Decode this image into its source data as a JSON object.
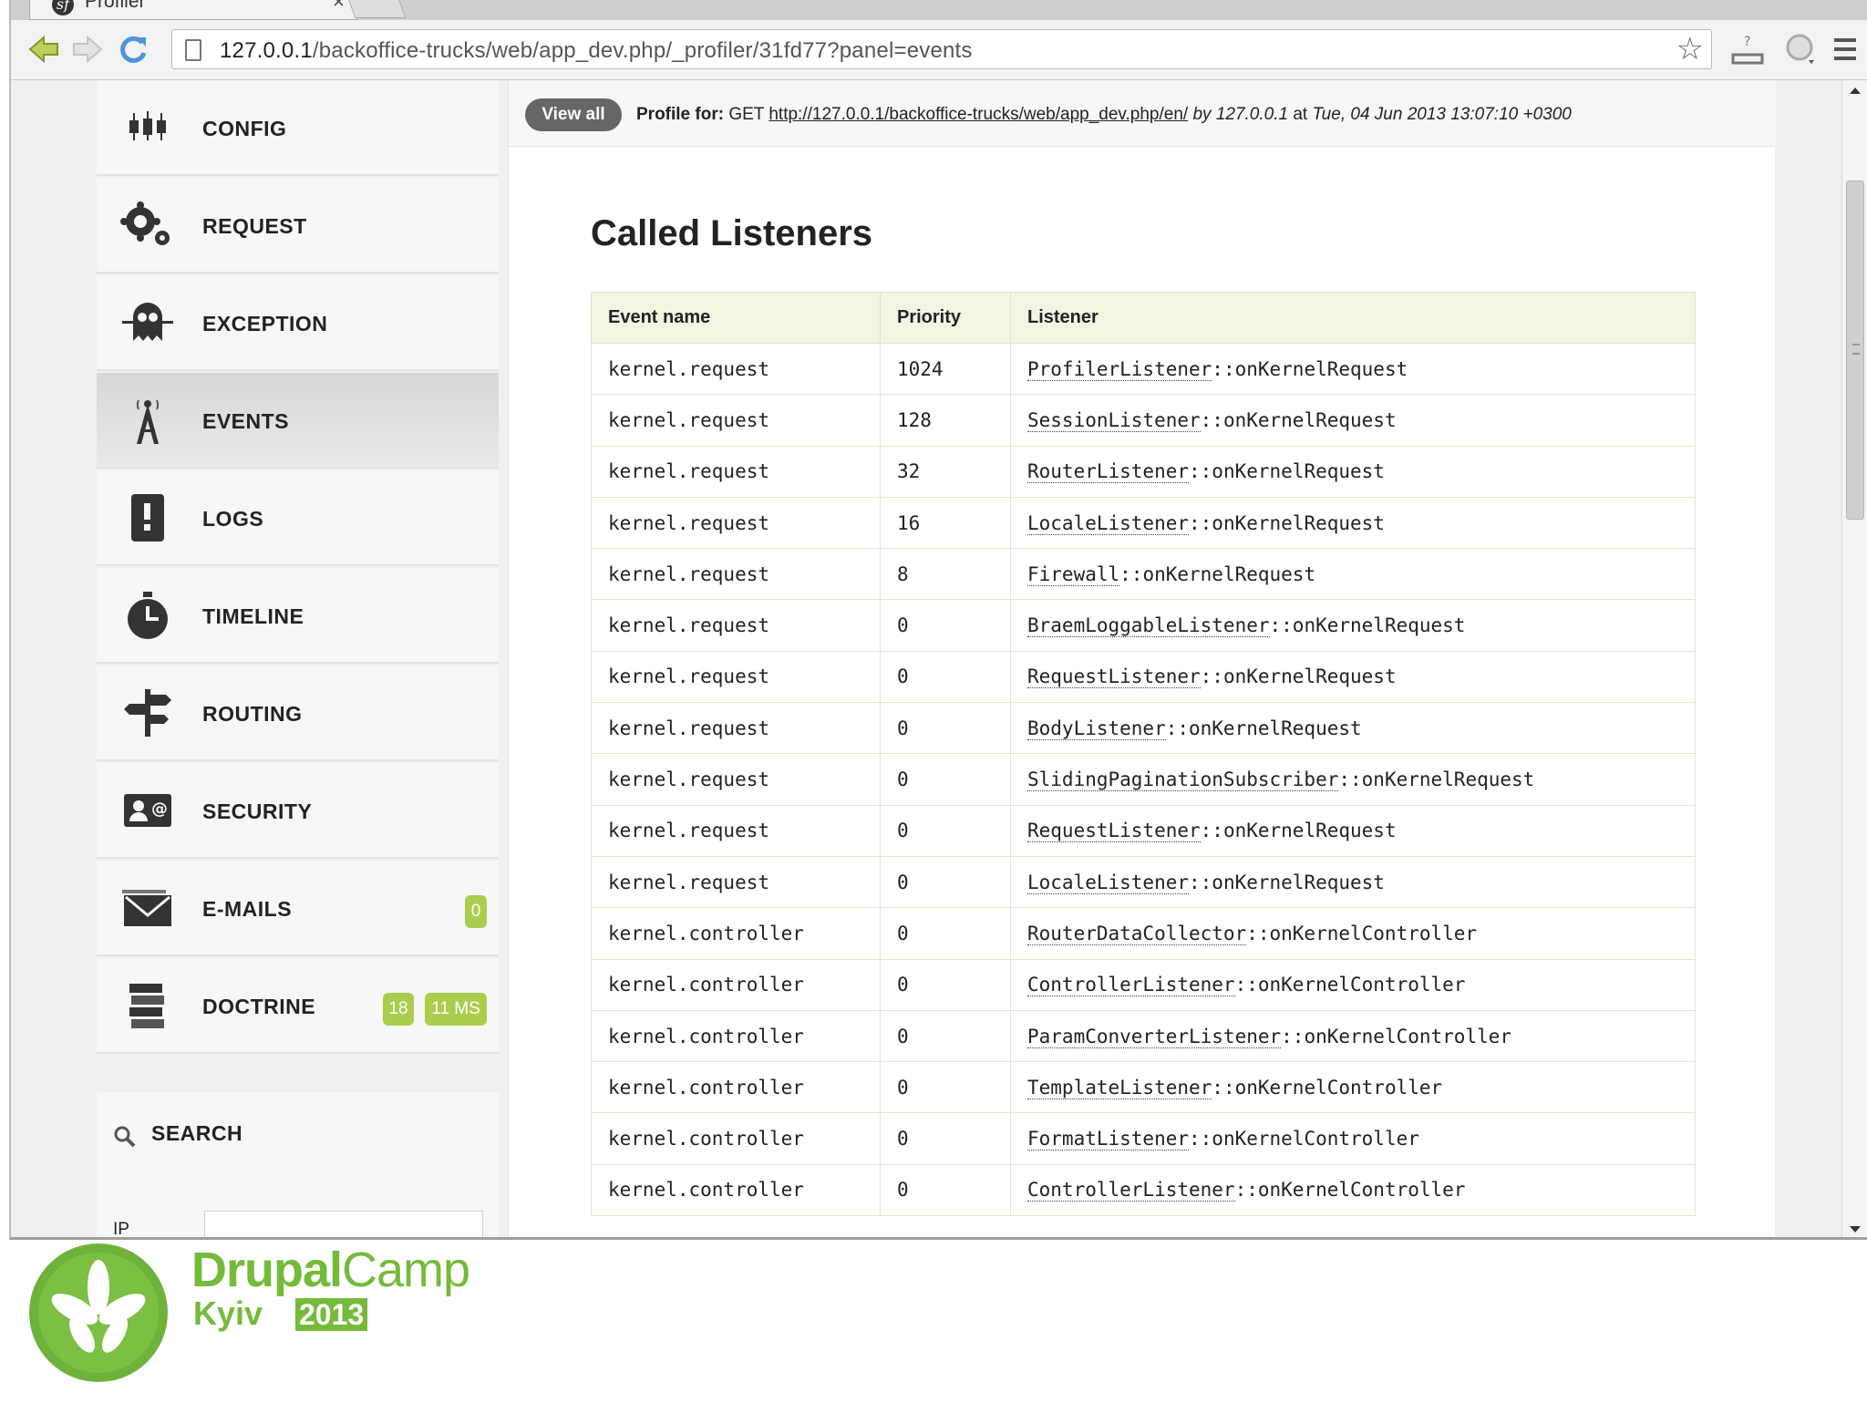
{
  "browser": {
    "tab_title": "Profiler",
    "tab_close": "×",
    "url_host": "127.0.0.1",
    "url_path": "/backoffice-trucks/web/app_dev.php/_profiler/31fd77?panel=events"
  },
  "sidebar": {
    "items": [
      {
        "label": "CONFIG",
        "icon": "config-icon"
      },
      {
        "label": "REQUEST",
        "icon": "gears-icon"
      },
      {
        "label": "EXCEPTION",
        "icon": "ghost-icon"
      },
      {
        "label": "EVENTS",
        "icon": "antenna-tower-icon",
        "active": true
      },
      {
        "label": "LOGS",
        "icon": "log-book-icon"
      },
      {
        "label": "TIMELINE",
        "icon": "stopwatch-icon"
      },
      {
        "label": "ROUTING",
        "icon": "signpost-icon"
      },
      {
        "label": "SECURITY",
        "icon": "id-card-icon"
      },
      {
        "label": "E-MAILS",
        "icon": "envelope-icon",
        "badge": "0"
      },
      {
        "label": "DOCTRINE",
        "icon": "database-icon",
        "badges": [
          "18",
          "11 MS"
        ]
      }
    ],
    "search": {
      "title": "SEARCH",
      "ip_label": "IP",
      "ip_value": ""
    }
  },
  "resume": {
    "view_all": "View all",
    "profile_for": "Profile for:",
    "method": "GET",
    "url": "http://127.0.0.1/backoffice-trucks/web/app_dev.php/en/",
    "by": "by",
    "ip": "127.0.0.1",
    "at": "at",
    "time": "Tue, 04 Jun 2013 13:07:10 +0300"
  },
  "events": {
    "title": "Called Listeners",
    "columns": [
      "Event name",
      "Priority",
      "Listener"
    ],
    "rows": [
      {
        "event": "kernel.request",
        "priority": "1024",
        "class": "ProfilerListener",
        "method": "::onKernelRequest"
      },
      {
        "event": "kernel.request",
        "priority": "128",
        "class": "SessionListener",
        "method": "::onKernelRequest"
      },
      {
        "event": "kernel.request",
        "priority": "32",
        "class": "RouterListener",
        "method": "::onKernelRequest"
      },
      {
        "event": "kernel.request",
        "priority": "16",
        "class": "LocaleListener",
        "method": "::onKernelRequest"
      },
      {
        "event": "kernel.request",
        "priority": "8",
        "class": "Firewall",
        "method": "::onKernelRequest"
      },
      {
        "event": "kernel.request",
        "priority": "0",
        "class": "BraemLoggableListener",
        "method": "::onKernelRequest"
      },
      {
        "event": "kernel.request",
        "priority": "0",
        "class": "RequestListener",
        "method": "::onKernelRequest"
      },
      {
        "event": "kernel.request",
        "priority": "0",
        "class": "BodyListener",
        "method": "::onKernelRequest"
      },
      {
        "event": "kernel.request",
        "priority": "0",
        "class": "SlidingPaginationSubscriber",
        "method": "::onKernelRequest"
      },
      {
        "event": "kernel.request",
        "priority": "0",
        "class": "RequestListener",
        "method": "::onKernelRequest"
      },
      {
        "event": "kernel.request",
        "priority": "0",
        "class": "LocaleListener",
        "method": "::onKernelRequest"
      },
      {
        "event": "kernel.controller",
        "priority": "0",
        "class": "RouterDataCollector",
        "method": "::onKernelController"
      },
      {
        "event": "kernel.controller",
        "priority": "0",
        "class": "ControllerListener",
        "method": "::onKernelController"
      },
      {
        "event": "kernel.controller",
        "priority": "0",
        "class": "ParamConverterListener",
        "method": "::onKernelController"
      },
      {
        "event": "kernel.controller",
        "priority": "0",
        "class": "TemplateListener",
        "method": "::onKernelController"
      },
      {
        "event": "kernel.controller",
        "priority": "0",
        "class": "FormatListener",
        "method": "::onKernelController"
      },
      {
        "event": "kernel.controller",
        "priority": "0",
        "class": "ControllerListener",
        "method": "::onKernelController"
      }
    ]
  },
  "watermark": {
    "title_a": "Drupal",
    "title_b": "Camp",
    "city": "Kyiv",
    "year": "2013"
  },
  "colors": {
    "badge": "#aacd4e",
    "table_header": "#f1f5e3",
    "drupalcamp_green": "#74bb3a"
  }
}
